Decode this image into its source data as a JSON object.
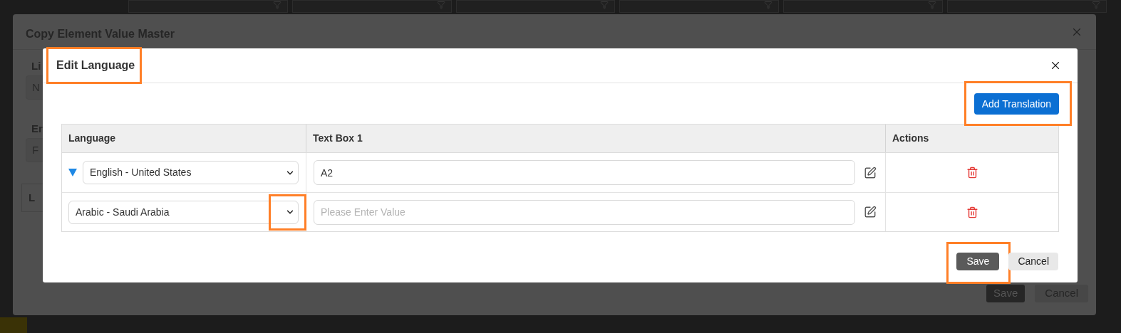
{
  "background_dialog": {
    "title": "Copy Element Value Master",
    "fields": [
      {
        "label": "Li",
        "value": "N"
      },
      {
        "label": "Er",
        "value": "F"
      }
    ],
    "table_header": "L",
    "buttons": [
      {
        "label": "Save",
        "kind": "primary"
      },
      {
        "label": "Cancel",
        "kind": "secondary"
      }
    ]
  },
  "dialog": {
    "title": "Edit Language",
    "title_highlighted": true,
    "add_button": {
      "label": "Add Translation",
      "highlighted": true
    },
    "columns": [
      "Language",
      "Text Box 1",
      "Actions"
    ],
    "rows": [
      {
        "language": "English - United States",
        "expanded": true,
        "caret_highlighted": false,
        "value": "A2"
      },
      {
        "language": "Arabic - Saudi Arabia",
        "expanded": false,
        "caret_highlighted": true,
        "placeholder": "Please Enter Value"
      }
    ],
    "buttons": [
      {
        "label": "Save",
        "kind": "primary",
        "highlighted": true
      },
      {
        "label": "Cancel",
        "kind": "secondary",
        "highlighted": false
      }
    ]
  }
}
